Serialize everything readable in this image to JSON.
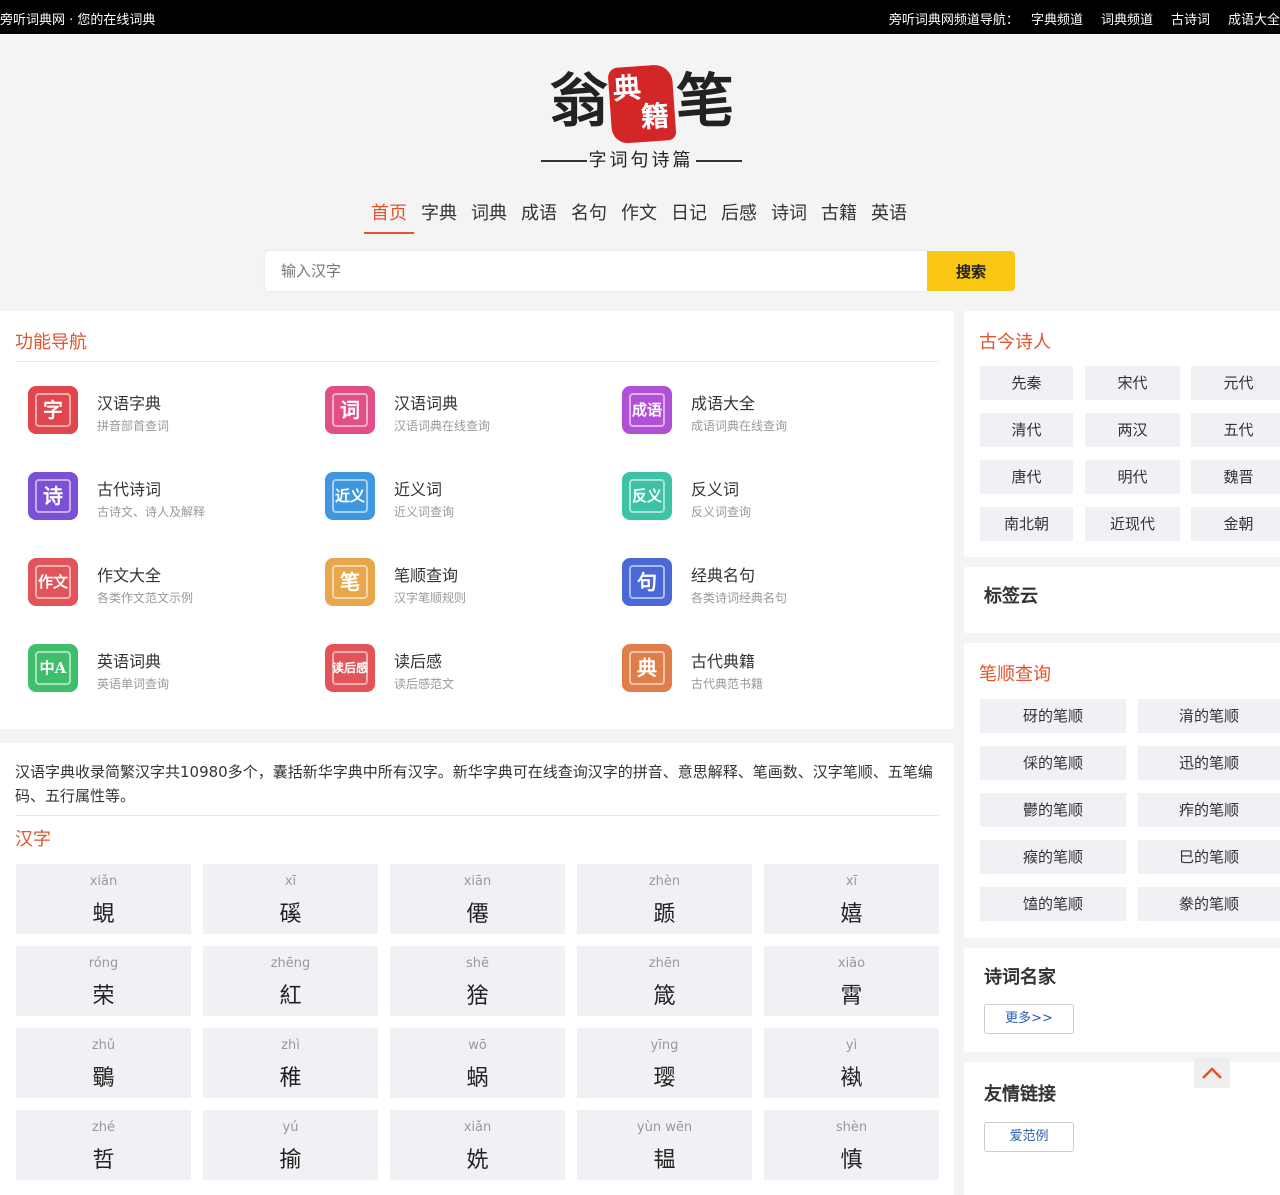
{
  "topbar": {
    "site_title": "旁听词典网 · 您的在线词典",
    "nav_label": "旁听词典网频道导航：",
    "links": [
      "字典频道",
      "词典频道",
      "古诗词",
      "成语大全"
    ]
  },
  "logo": {
    "left_char": "翁",
    "seal_chars": [
      "典",
      "籍"
    ],
    "right_char": "笔",
    "slogan": "字词句诗篇"
  },
  "nav": {
    "items": [
      "首页",
      "字典",
      "词典",
      "成语",
      "名句",
      "作文",
      "日记",
      "后感",
      "诗词",
      "古籍",
      "英语"
    ],
    "active": "首页"
  },
  "search": {
    "placeholder": "输入汉字",
    "value": "",
    "button": "搜索"
  },
  "func_nav": {
    "title": "功能导航",
    "items": [
      {
        "icon": "字",
        "name": "汉语字典",
        "desc": "拼音部首查词",
        "color": "#e0464c"
      },
      {
        "icon": "词",
        "name": "汉语词典",
        "desc": "汉语词典在线查询",
        "color": "#e24f86"
      },
      {
        "icon": "成语",
        "name": "成语大全",
        "desc": "成语词典在线查询",
        "color": "#b050d6"
      },
      {
        "icon": "诗",
        "name": "古代诗词",
        "desc": "古诗文、诗人及解释",
        "color": "#7b4fd6"
      },
      {
        "icon": "近义",
        "name": "近义词",
        "desc": "近义词查询",
        "color": "#3f97df"
      },
      {
        "icon": "反义",
        "name": "反义词",
        "desc": "反义词查询",
        "color": "#3dc2a5"
      },
      {
        "icon": "作文",
        "name": "作文大全",
        "desc": "各类作文范文示例",
        "color": "#e25459"
      },
      {
        "icon": "笔",
        "name": "笔顺查询",
        "desc": "汉字笔顺规则",
        "color": "#e8a74a"
      },
      {
        "icon": "句",
        "name": "经典名句",
        "desc": "各类诗词经典名句",
        "color": "#4a68d8"
      },
      {
        "icon": "中A",
        "name": "英语词典",
        "desc": "英语单词查询",
        "color": "#3fbf6c"
      },
      {
        "icon": "读后感",
        "name": "读后感",
        "desc": "读后感范文",
        "color": "#e25459"
      },
      {
        "icon": "典",
        "name": "古代典籍",
        "desc": "古代典范书籍",
        "color": "#e07d49"
      }
    ]
  },
  "hanzi": {
    "intro": "汉语字典收录简繁汉字共10980多个，囊括新华字典中所有汉字。新华字典可在线查询汉字的拼音、意思解释、笔画数、汉字笔顺、五笔编码、五行属性等。",
    "title": "汉字",
    "chars": [
      {
        "py": "xiǎn",
        "ch": "蜆"
      },
      {
        "py": "xī",
        "ch": "磎"
      },
      {
        "py": "xiān",
        "ch": "僊"
      },
      {
        "py": "zhèn",
        "ch": "踬"
      },
      {
        "py": "xī",
        "ch": "嬉"
      },
      {
        "py": "róng",
        "ch": "荣"
      },
      {
        "py": "zhēng",
        "ch": "紅"
      },
      {
        "py": "shē",
        "ch": "猞"
      },
      {
        "py": "zhēn",
        "ch": "箴"
      },
      {
        "py": "xiāo",
        "ch": "霄"
      },
      {
        "py": "zhǔ",
        "ch": "鸀"
      },
      {
        "py": "zhì",
        "ch": "稚"
      },
      {
        "py": "wō",
        "ch": "蜗"
      },
      {
        "py": "yīng",
        "ch": "璎"
      },
      {
        "py": "yì",
        "ch": "褹"
      },
      {
        "py": "zhé",
        "ch": "哲"
      },
      {
        "py": "yú",
        "ch": "揄"
      },
      {
        "py": "xiǎn",
        "ch": "姺"
      },
      {
        "py": "yùn wēn",
        "ch": "韫"
      },
      {
        "py": "shèn",
        "ch": "慎"
      }
    ]
  },
  "poets": {
    "title": "古今诗人",
    "eras": [
      "先秦",
      "宋代",
      "元代",
      "清代",
      "两汉",
      "五代",
      "唐代",
      "明代",
      "魏晋",
      "南北朝",
      "近现代",
      "金朝"
    ]
  },
  "tagcloud": {
    "title": "标签云"
  },
  "stroke": {
    "title": "笔顺查询",
    "items": [
      "砑的笔顺",
      "湇的笔顺",
      "倸的笔顺",
      "迅的笔顺",
      "鬱的笔顺",
      "痄的笔顺",
      "瘊的笔顺",
      "巳的笔顺",
      "馌的笔顺",
      "豢的笔顺"
    ]
  },
  "poetmaster": {
    "title": "诗词名家",
    "more": "更多>>"
  },
  "links": {
    "title": "友情链接",
    "items": [
      "爱范例"
    ]
  },
  "icons": {
    "totop": "chevron-up-icon"
  }
}
